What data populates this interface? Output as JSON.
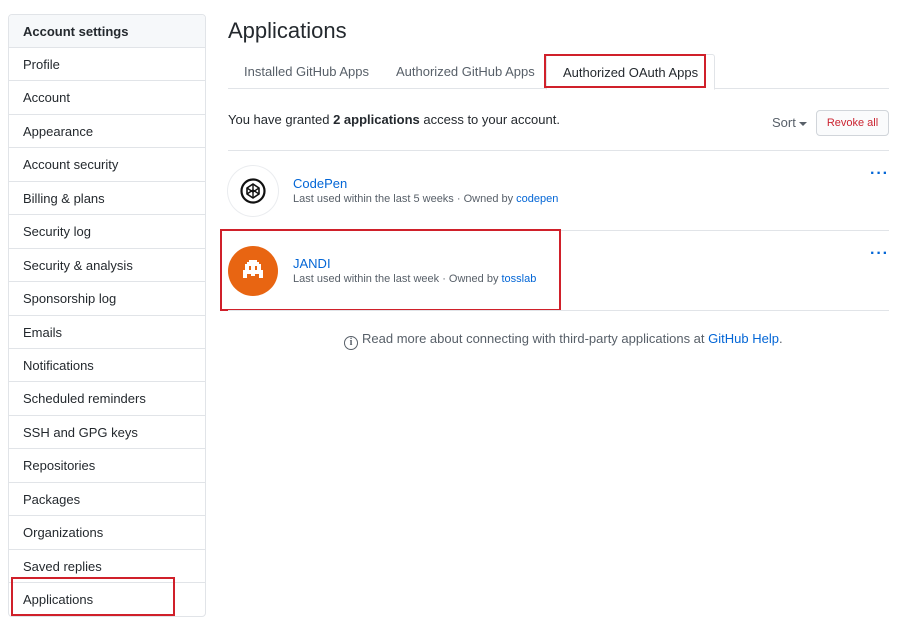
{
  "sidebar": {
    "header": "Account settings",
    "items": [
      {
        "label": "Profile"
      },
      {
        "label": "Account"
      },
      {
        "label": "Appearance"
      },
      {
        "label": "Account security"
      },
      {
        "label": "Billing & plans"
      },
      {
        "label": "Security log"
      },
      {
        "label": "Security & analysis"
      },
      {
        "label": "Sponsorship log"
      },
      {
        "label": "Emails"
      },
      {
        "label": "Notifications"
      },
      {
        "label": "Scheduled reminders"
      },
      {
        "label": "SSH and GPG keys"
      },
      {
        "label": "Repositories"
      },
      {
        "label": "Packages"
      },
      {
        "label": "Organizations"
      },
      {
        "label": "Saved replies"
      },
      {
        "label": "Applications"
      }
    ]
  },
  "main": {
    "title": "Applications",
    "tabs": [
      {
        "label": "Installed GitHub Apps"
      },
      {
        "label": "Authorized GitHub Apps"
      },
      {
        "label": "Authorized OAuth Apps",
        "selected": true
      }
    ],
    "granted_prefix": "You have granted ",
    "granted_count": "2 applications",
    "granted_suffix": " access to your account.",
    "sort_label": "Sort",
    "revoke_all_label": "Revoke all",
    "apps": [
      {
        "name": "CodePen",
        "meta_prefix": "Last used within the last 5 weeks · Owned by ",
        "owner": "codepen",
        "icon": "codepen-logo-icon"
      },
      {
        "name": "JANDI",
        "meta_prefix": "Last used within the last week · Owned by ",
        "owner": "tosslab",
        "icon": "jandi-logo-icon",
        "avatar_color": "#e86512"
      }
    ],
    "actions_glyph": "···",
    "info_glyph": "i",
    "help_prefix": "Read more about connecting with third-party applications at ",
    "help_link": "GitHub Help",
    "help_suffix": "."
  },
  "colors": {
    "link": "#0366d6",
    "danger": "#cb2431",
    "highlight": "#d0202a",
    "border": "#e1e4e8"
  }
}
